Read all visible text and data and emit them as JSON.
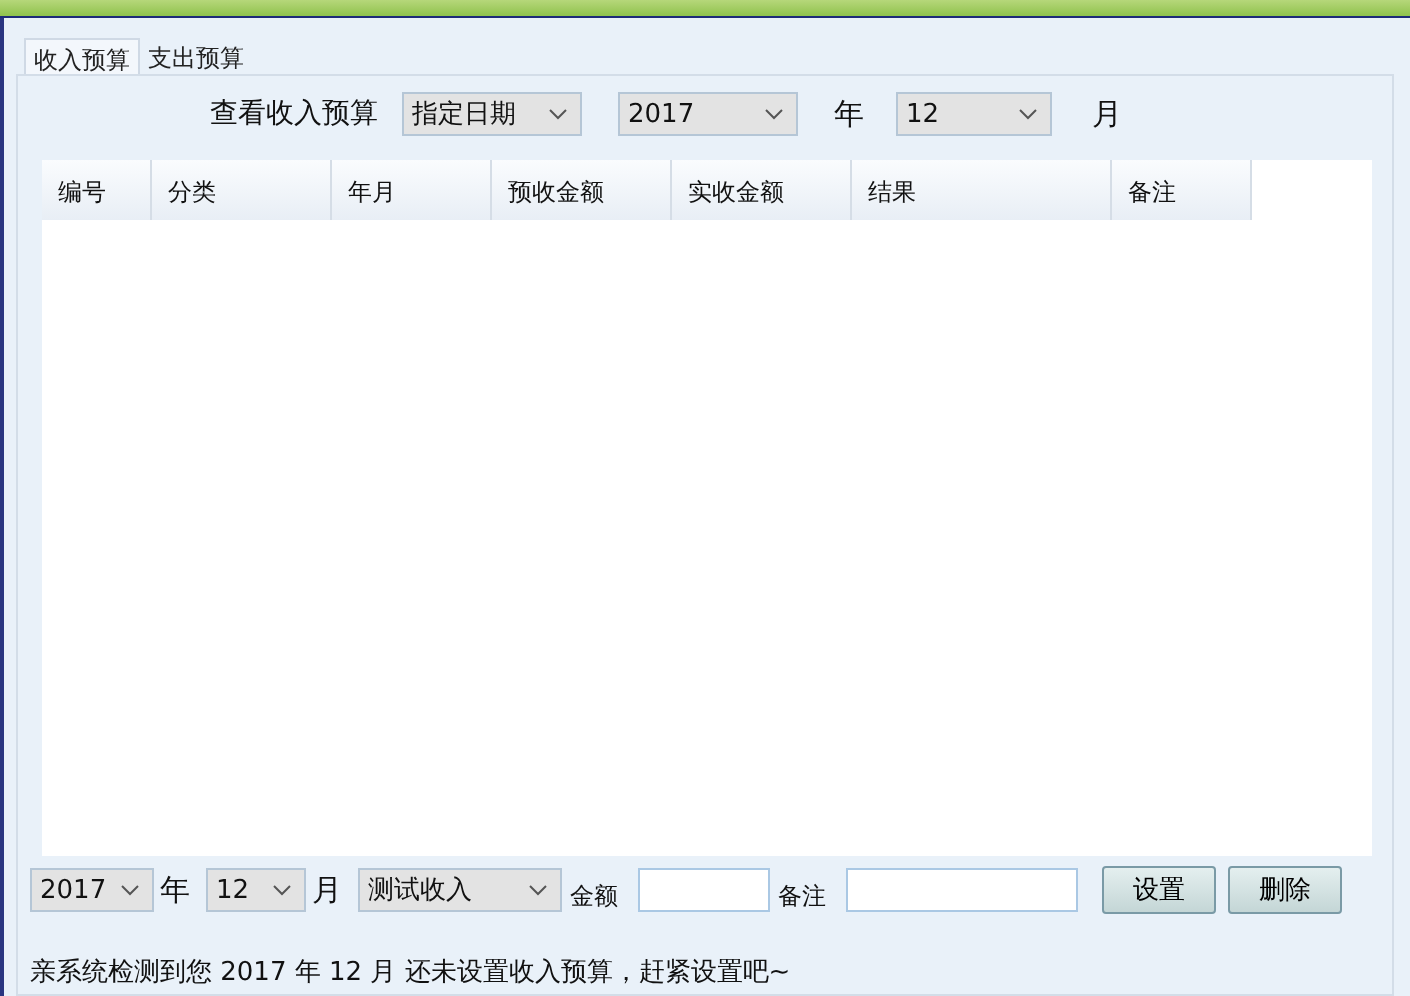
{
  "tabs": [
    {
      "label": "收入预算",
      "selected": true
    },
    {
      "label": "支出预算",
      "selected": false
    }
  ],
  "filter": {
    "label": "查看收入预算",
    "mode": "指定日期",
    "year": "2017",
    "year_unit": "年",
    "month": "12",
    "month_unit": "月"
  },
  "table": {
    "columns": [
      "编号",
      "分类",
      "年月",
      "预收金额",
      "实收金额",
      "结果",
      "备注"
    ]
  },
  "form": {
    "year": "2017",
    "year_unit": "年",
    "month": "12",
    "month_unit": "月",
    "category": "测试收入",
    "amount_label": "金额",
    "note_label": "备注",
    "buttons": [
      "设置",
      "删除"
    ]
  },
  "status_bar": "亲系统检测到您 2017 年 12 月 还未设置收入预算，赶紧设置吧~"
}
